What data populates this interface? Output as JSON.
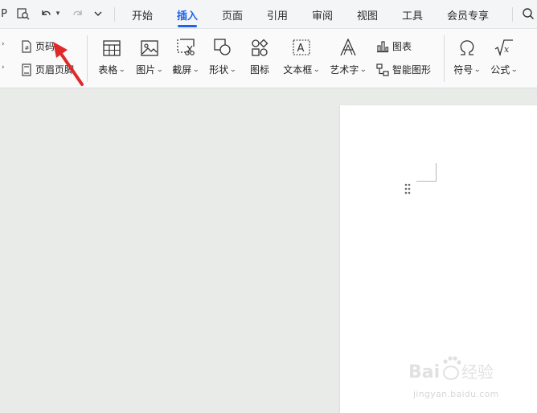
{
  "quick_access": {
    "icons": [
      "print-icon",
      "print-preview-icon",
      "undo-icon",
      "redo-icon",
      "more-dropdown-icon"
    ],
    "left_clipped_glyph": "P"
  },
  "tabs": [
    {
      "label": "开始",
      "active": false
    },
    {
      "label": "插入",
      "active": true
    },
    {
      "label": "页面",
      "active": false
    },
    {
      "label": "引用",
      "active": false
    },
    {
      "label": "审阅",
      "active": false
    },
    {
      "label": "视图",
      "active": false
    },
    {
      "label": "工具",
      "active": false
    },
    {
      "label": "会员专享",
      "active": false
    }
  ],
  "ribbon": {
    "page_number": "页码",
    "header_footer": "页眉页脚",
    "table": "表格",
    "picture": "图片",
    "screenshot": "截屏",
    "shapes": "形状",
    "icons": "图标",
    "textbox": "文本框",
    "wordart": "艺术字",
    "chart": "图表",
    "smart_graphic": "智能图形",
    "symbol": "符号",
    "formula": "公式"
  },
  "colors": {
    "accent": "#1e63f0",
    "annotation_arrow": "#e02a2a",
    "canvas_bg": "#e9ebe9",
    "page_bg": "#ffffff"
  },
  "watermark": {
    "brand": "Baidu经验",
    "url": "jingyan.baidu.com"
  }
}
